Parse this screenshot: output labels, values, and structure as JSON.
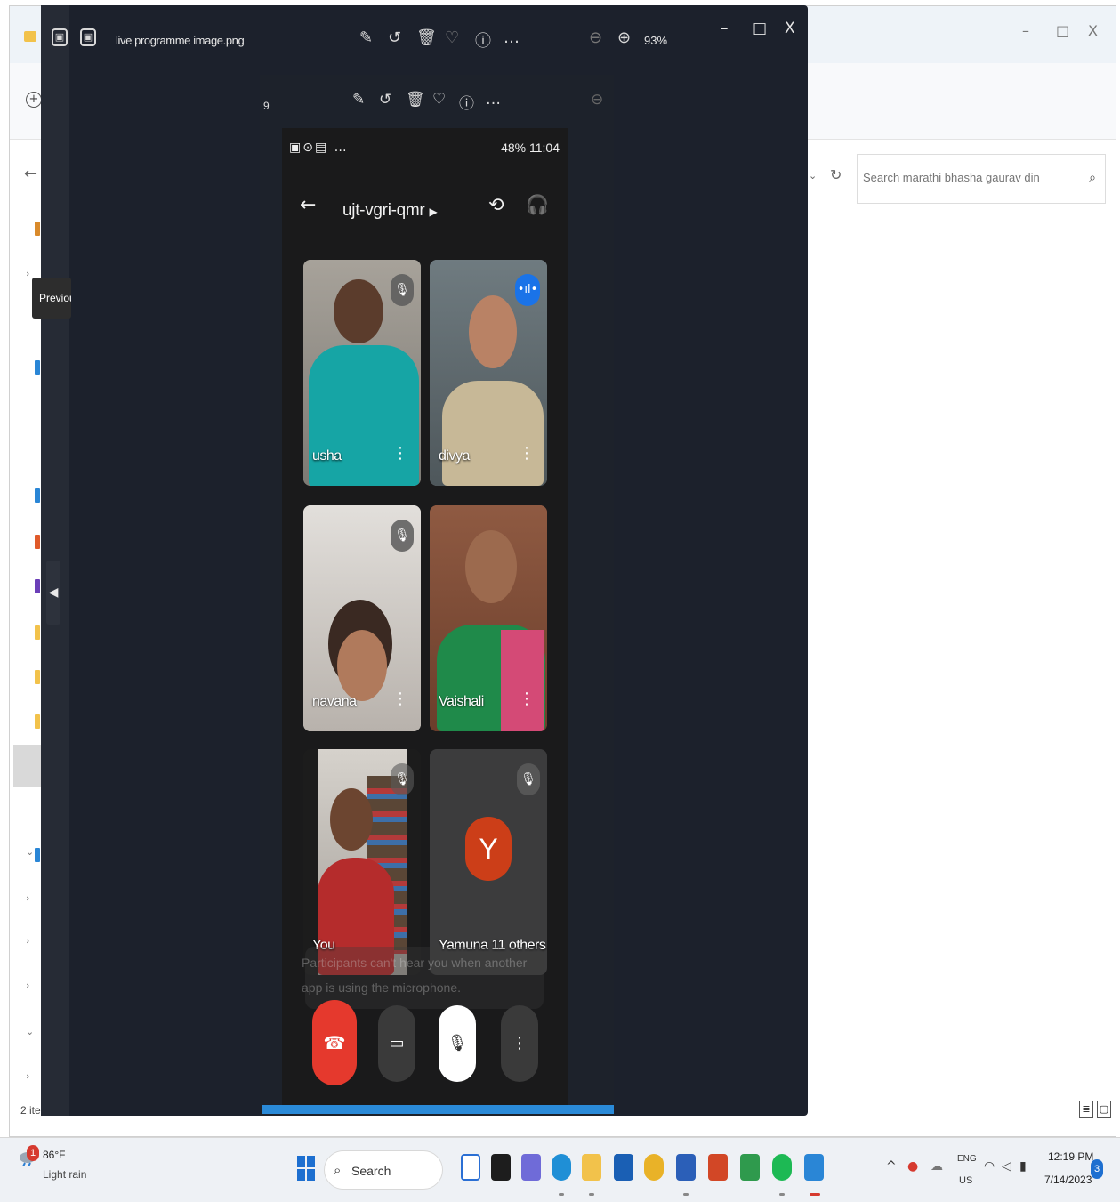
{
  "explorer": {
    "search_placeholder": "Search marathi bhasha gaurav din",
    "status_text": "2 ite",
    "tooltip": "Previou",
    "minimize": "–",
    "maximize": "□",
    "close": "X"
  },
  "viewer": {
    "file_name": "live programme image.png",
    "zoom": "93%",
    "minimize": "–",
    "maximize": "□",
    "close": "X",
    "inner_page_label": "9"
  },
  "phone": {
    "status_right": "48%  11:04",
    "meeting_code": "ujt-vgri-qmr",
    "participants": [
      {
        "name": "usha",
        "muted": true
      },
      {
        "name": "divya",
        "speaking": true
      },
      {
        "name": "navana",
        "muted": true
      },
      {
        "name": "Vaishali",
        "muted": false
      },
      {
        "name": "You",
        "muted": true
      },
      {
        "name": "Yamuna  11 others",
        "avatar_letter": "Y",
        "muted": true
      }
    ],
    "notice": "Participants can't hear you when another app is using the microphone."
  },
  "taskbar": {
    "weather_badge": "1",
    "temperature": "86°F",
    "condition": "Light rain",
    "search_label": "Search",
    "lang_top": "ENG",
    "lang_bottom": "US",
    "time": "12:19 PM",
    "date": "7/14/2023",
    "notification_count": "3"
  },
  "colors": {
    "viewer_bg": "#1c212c",
    "end_call": "#e5392d",
    "avatar": "#cc3e18",
    "speaking": "#1a73e8"
  }
}
